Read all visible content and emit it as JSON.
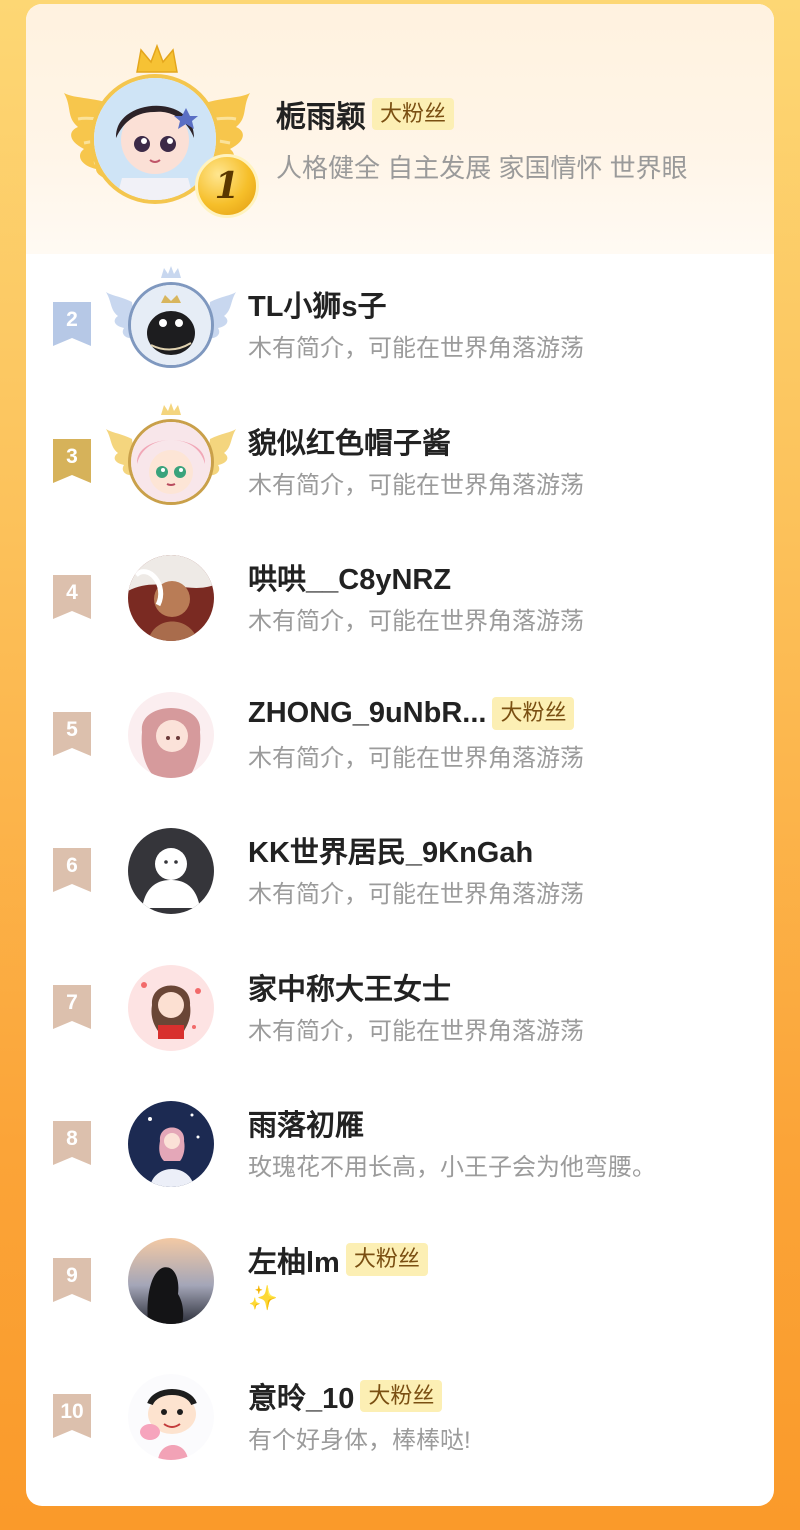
{
  "top": {
    "name": "栀雨颖",
    "badge": "大粉丝",
    "bio": "人格健全 自主发展 家国情怀 世界眼",
    "rank": "1"
  },
  "ranks": [
    {
      "rank": "2",
      "name": "TL小狮s子",
      "badge": "",
      "bio": "木有简介，可能在世界角落游荡",
      "tag_color": "#b6c8e6",
      "frame": "silver"
    },
    {
      "rank": "3",
      "name": "貌似红色帽子酱",
      "badge": "",
      "bio": "木有简介，可能在世界角落游荡",
      "tag_color": "#d6b25a",
      "frame": "gold"
    },
    {
      "rank": "4",
      "name": "哄哄__C8yNRZ",
      "badge": "",
      "bio": "木有简介，可能在世界角落游荡",
      "tag_color": "#dcc0ad",
      "frame": "none"
    },
    {
      "rank": "5",
      "name": "ZHONG_9uNbR...",
      "badge": "大粉丝",
      "bio": "木有简介，可能在世界角落游荡",
      "tag_color": "#dcc0ad",
      "frame": "none"
    },
    {
      "rank": "6",
      "name": "KK世界居民_9KnGah",
      "badge": "",
      "bio": "木有简介，可能在世界角落游荡",
      "tag_color": "#dcc0ad",
      "frame": "none"
    },
    {
      "rank": "7",
      "name": "家中称大王女士",
      "badge": "",
      "bio": "木有简介，可能在世界角落游荡",
      "tag_color": "#dcc0ad",
      "frame": "none"
    },
    {
      "rank": "8",
      "name": "雨落初雁",
      "badge": "",
      "bio": "玫瑰花不用长高，小王子会为他弯腰。",
      "tag_color": "#dcc0ad",
      "frame": "none"
    },
    {
      "rank": "9",
      "name": "左柚lm",
      "badge": "大粉丝",
      "bio": "✨",
      "tag_color": "#dcc0ad",
      "frame": "none"
    },
    {
      "rank": "10",
      "name": "意昤_10",
      "badge": "大粉丝",
      "bio": "有个好身体，棒棒哒!",
      "tag_color": "#dcc0ad",
      "frame": "none"
    }
  ],
  "colors": {
    "gold": "#f4c64e",
    "silver": "#7f98bf",
    "bronze_gold": "#c9a04a",
    "badge_bg": "#fcefb4",
    "badge_text": "#7a4f12",
    "gradient_top": "#fdd774",
    "gradient_bottom": "#fa9a2a"
  },
  "icons": {
    "crown": "crown-icon",
    "wing": "wing-icon",
    "medal": "medal-1-icon",
    "rank_tag": "ribbon-tag-icon"
  }
}
